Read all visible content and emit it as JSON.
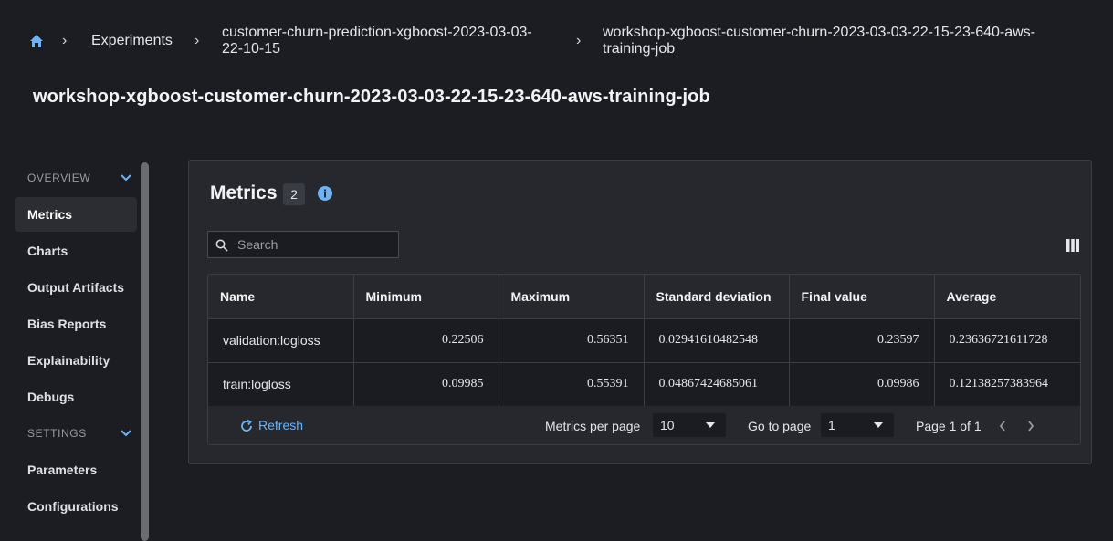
{
  "breadcrumb": {
    "home_icon": "home-icon",
    "items": [
      {
        "label": "Experiments"
      },
      {
        "label": "customer-churn-prediction-xgboost-2023-03-03-",
        "label2": "22-10-15"
      },
      {
        "label": "workshop-xgboost-customer-churn-2023-03-03-22-15-23-640-aws-",
        "label2": "training-job"
      }
    ]
  },
  "page_title": "workshop-xgboost-customer-churn-2023-03-03-22-15-23-640-aws-training-job",
  "sidebar": {
    "overview_label": "OVERVIEW",
    "overview_items": [
      {
        "label": "Metrics",
        "active": true
      },
      {
        "label": "Charts"
      },
      {
        "label": "Output Artifacts"
      },
      {
        "label": "Bias Reports"
      },
      {
        "label": "Explainability"
      },
      {
        "label": "Debugs"
      }
    ],
    "settings_label": "SETTINGS",
    "settings_items": [
      {
        "label": "Parameters"
      },
      {
        "label": "Configurations"
      }
    ]
  },
  "metrics": {
    "title": "Metrics",
    "count": "2",
    "search_placeholder": "Search",
    "columns": [
      "Name",
      "Minimum",
      "Maximum",
      "Standard deviation",
      "Final value",
      "Average"
    ],
    "rows": [
      [
        "validation:logloss",
        "0.22506",
        "0.56351",
        "0.02941610482548",
        "0.23597",
        "0.23636721611728"
      ],
      [
        "train:logloss",
        "0.09985",
        "0.55391",
        "0.04867424685061",
        "0.09986",
        "0.12138257383964"
      ]
    ],
    "footer": {
      "refresh_label": "Refresh",
      "per_page_label": "Metrics per page",
      "per_page_value": "10",
      "go_to_label": "Go to page",
      "go_to_value": "1",
      "page_info": "Page 1 of 1"
    }
  },
  "colors": {
    "background": "#1c1d22",
    "panel": "#26282e",
    "accent": "#6fb2f3"
  }
}
